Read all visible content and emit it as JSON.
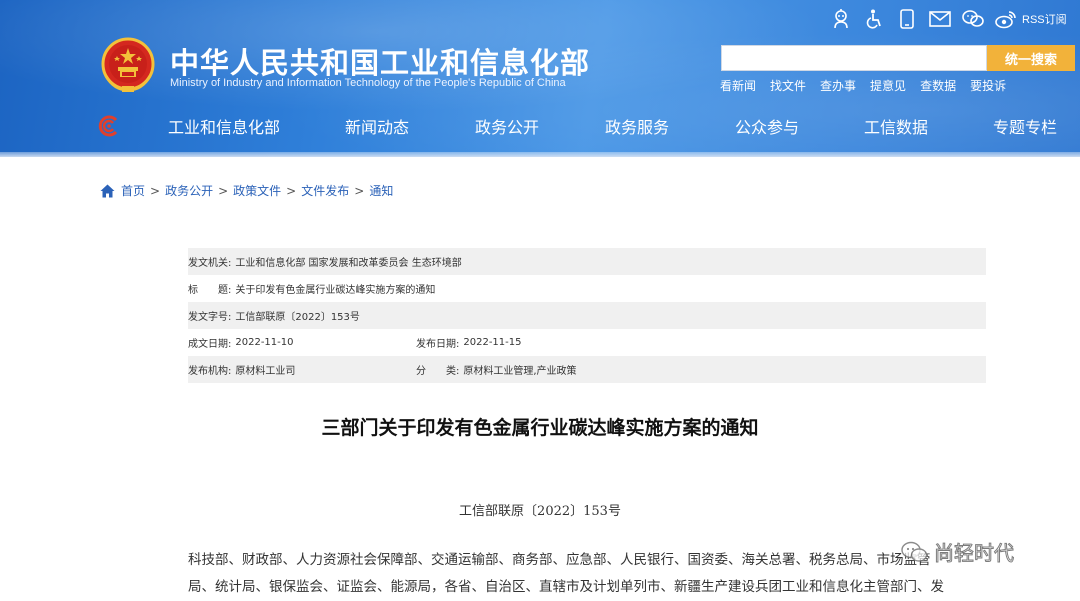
{
  "site": {
    "title_cn": "中华人民共和国工业和信息化部",
    "title_en": "Ministry of Industry and Information Technology of the People's Republic of China"
  },
  "utility": {
    "icons": [
      "robot-icon",
      "accessibility-icon",
      "mobile-icon",
      "mail-icon",
      "wechat-icon",
      "weibo-icon"
    ],
    "rss_label": "RSS订阅"
  },
  "search": {
    "value": "",
    "placeholder": "",
    "button_label": "统一搜索"
  },
  "quick_links": [
    "看新闻",
    "找文件",
    "查办事",
    "提意见",
    "查数据",
    "要投诉"
  ],
  "nav": [
    "工业和信息化部",
    "新闻动态",
    "政务公开",
    "政务服务",
    "公众参与",
    "工信数据",
    "专题专栏"
  ],
  "breadcrumb": [
    "首页",
    "政务公开",
    "政策文件",
    "文件发布",
    "通知"
  ],
  "breadcrumb_sep": ">",
  "info": {
    "issuer_key": "发文机关:",
    "issuer_val": "工业和信息化部 国家发展和改革委员会 生态环境部",
    "title_key": "标　　题:",
    "title_val": "关于印发有色金属行业碳达峰实施方案的通知",
    "docno_key": "发文字号:",
    "docno_val": "工信部联原〔2022〕153号",
    "created_key": "成文日期:",
    "created_val": "2022-11-10",
    "published_key": "发布日期:",
    "published_val": "2022-11-15",
    "org_key": "发布机构:",
    "org_val": "原材料工业司",
    "category_key": "分　　类:",
    "category_val": "原材料工业管理,产业政策"
  },
  "article": {
    "title": "三部门关于印发有色金属行业碳达峰实施方案的通知",
    "doc_no": "工信部联原〔2022〕153号",
    "body_lines": [
      "科技部、财政部、人力资源社会保障部、交通运输部、商务部、应急部、人民银行、国资委、海关总署、税务总局、市场监管",
      "局、统计局、银保监会、证监会、能源局，各省、自治区、直辖市及计划单列市、新疆生产建设兵团工业和信息化主管部门、发"
    ]
  },
  "watermark": {
    "text": "尚轻时代"
  },
  "colors": {
    "header_blue": "#2f7fd9",
    "search_button": "#f2b23a",
    "breadcrumb_link": "#2b62b8",
    "info_row_shade": "#f0f0f0"
  }
}
